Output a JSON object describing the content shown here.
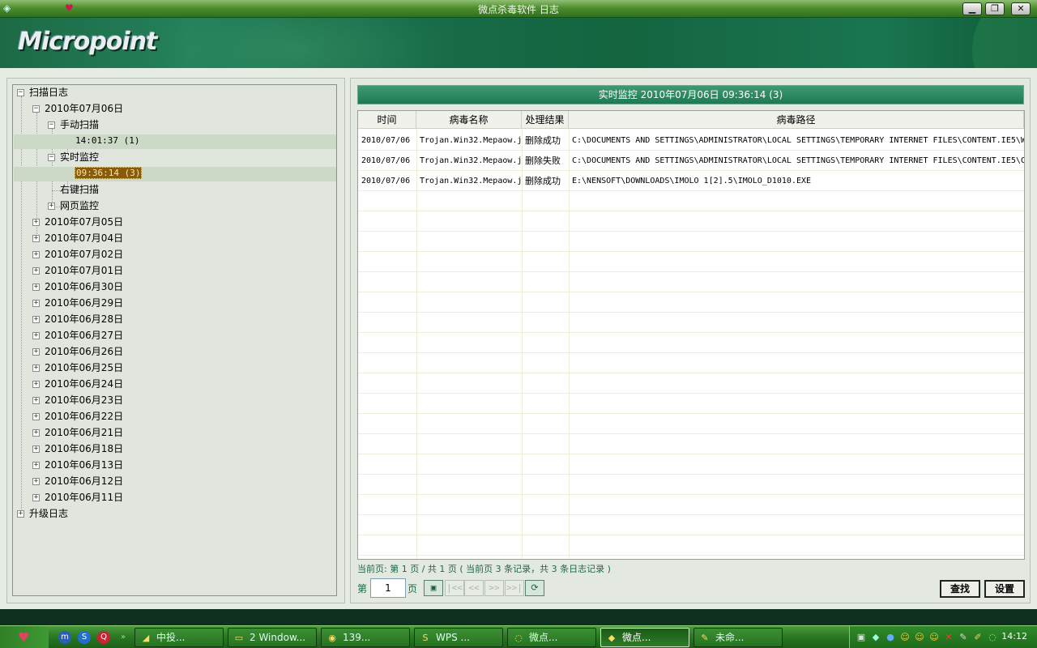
{
  "window": {
    "title": "微点杀毒软件 日志",
    "logo_text": "Micropoint",
    "controls": {
      "minimize": "▁",
      "restore": "❐",
      "close": "✕"
    }
  },
  "tree": {
    "root": "扫描日志",
    "date_open": "2010年07月06日",
    "manual_scan": "手动扫描",
    "manual_entry": "14:01:37 (1)",
    "realtime": "实时监控",
    "realtime_entry": "09:36:14 (3)",
    "rightclick": "右键扫描",
    "web_monitor": "网页监控",
    "other_dates": [
      "2010年07月05日",
      "2010年07月04日",
      "2010年07月02日",
      "2010年07月01日",
      "2010年06月30日",
      "2010年06月29日",
      "2010年06月28日",
      "2010年06月27日",
      "2010年06月26日",
      "2010年06月25日",
      "2010年06月24日",
      "2010年06月23日",
      "2010年06月22日",
      "2010年06月21日",
      "2010年06月18日",
      "2010年06月13日",
      "2010年06月12日",
      "2010年06月11日"
    ],
    "upgrade_log": "升级日志",
    "expander_plus": "+",
    "expander_minus": "−"
  },
  "grid": {
    "header_title": "实时监控 2010年07月06日 09:36:14 (3)",
    "columns": [
      "时间",
      "病毒名称",
      "处理结果",
      "病毒路径"
    ],
    "rows": [
      [
        "2010/07/06",
        "Trojan.Win32.Mepaow.j",
        "删除成功",
        "C:\\DOCUMENTS AND SETTINGS\\ADMINISTRATOR\\LOCAL SETTINGS\\TEMPORARY INTERNET FILES\\CONTENT.IE5\\W"
      ],
      [
        "2010/07/06",
        "Trojan.Win32.Mepaow.j",
        "删除失败",
        "C:\\DOCUMENTS AND SETTINGS\\ADMINISTRATOR\\LOCAL SETTINGS\\TEMPORARY INTERNET FILES\\CONTENT.IE5\\C"
      ],
      [
        "2010/07/06",
        "Trojan.Win32.Mepaow.j",
        "删除成功",
        "E:\\NENSOFT\\DOWNLOADS\\IMOLO 1[2].5\\IMOLO_D1010.EXE"
      ]
    ]
  },
  "pager": {
    "info": "当前页: 第 1 页 / 共 1 页 ( 当前页 3 条记录，共 3 条日志记录 )",
    "prefix": "第",
    "page_value": "1",
    "suffix": "页",
    "first": "|<<",
    "prev": "<<",
    "next": ">>",
    "last": ">>|",
    "save_icon": "▣",
    "refresh_icon": "⟳",
    "find_label": "查找",
    "settings_label": "设置"
  },
  "taskbar": {
    "tasks": [
      {
        "icon": "◢",
        "label": "中投..."
      },
      {
        "icon": "▭",
        "label": "2 Window..."
      },
      {
        "icon": "◉",
        "label": "139..."
      },
      {
        "icon": "S",
        "label": "WPS ..."
      },
      {
        "icon": "◌",
        "label": "微点..."
      },
      {
        "icon": "◆",
        "label": "微点..."
      },
      {
        "icon": "✎",
        "label": "未命..."
      }
    ],
    "clock": "14:12"
  }
}
